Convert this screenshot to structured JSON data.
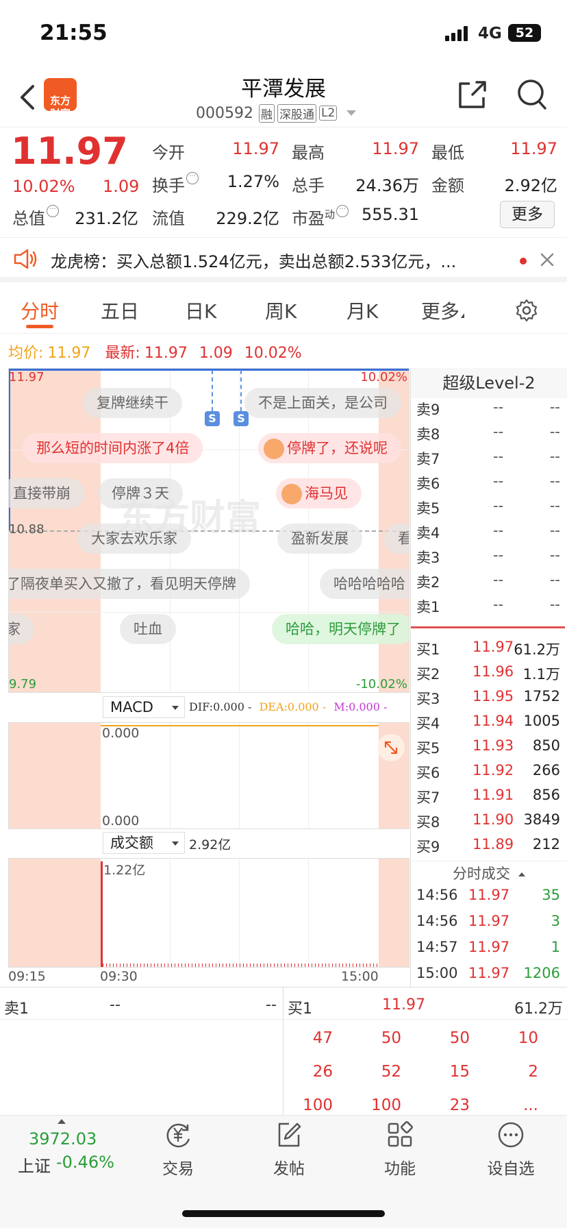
{
  "status": {
    "time": "21:55",
    "network": "4G",
    "battery": "52"
  },
  "nav": {
    "brand": "东方\n财富",
    "title": "平潭发展",
    "code": "000592",
    "badges": [
      "融",
      "深股通",
      "L2"
    ]
  },
  "quote": {
    "price": "11.97",
    "change_pct": "10.02%",
    "change": "1.09",
    "labels": {
      "open": "今开",
      "high": "最高",
      "low": "最低",
      "turnover_rate": "换手",
      "volume": "总手",
      "amount": "金额",
      "total_mv": "总值",
      "float_mv": "流值",
      "pe": "市盈",
      "pe_sup": "动",
      "more": "更多"
    },
    "values": {
      "open": "11.97",
      "high": "11.97",
      "low": "11.97",
      "turnover_rate": "1.27%",
      "volume": "24.36万",
      "amount": "2.92亿",
      "total_mv": "231.2亿",
      "float_mv": "229.2亿",
      "pe": "555.31"
    }
  },
  "notice": {
    "text": "龙虎榜：买入总额1.524亿元，卖出总额2.533亿元，..."
  },
  "tabs": [
    "分时",
    "五日",
    "日K",
    "周K",
    "月K",
    "更多"
  ],
  "info_line": {
    "avg_label": "均价:",
    "avg": "11.97",
    "last_label": "最新:",
    "last": "11.97",
    "chg": "1.09",
    "pct": "10.02%"
  },
  "chart": {
    "y_top": "11.97",
    "y_mid": "10.88",
    "y_bot": "9.79",
    "pct_top": "10.02%",
    "pct_bot": "-10.02%",
    "macd": {
      "label": "MACD",
      "dif": "DIF:0.000 -",
      "dea": "DEA:0.000 -",
      "m": "M:0.000 -",
      "top": "0.000",
      "bot": "0.000"
    },
    "vol": {
      "label": "成交额",
      "total": "2.92亿",
      "peak": "1.22亿"
    },
    "times": [
      "09:15",
      "09:30",
      "15:00"
    ],
    "markers": [
      "S",
      "S"
    ],
    "danmu": [
      "复牌继续干",
      "不是上面关，是公司",
      "那么短的时间内涨了4倍",
      "停牌了，还说呢",
      "直接带崩",
      "停牌３天",
      "海马见",
      "大家去欢乐家",
      "盈新发展",
      "看",
      "了隔夜单买入又撤了，看见明天停牌",
      "哈哈哈哈哈",
      "家",
      "吐血",
      "哈哈，明天停牌了"
    ]
  },
  "chart_data": {
    "type": "line",
    "title": "",
    "x": [
      "09:15",
      "09:30",
      "15:00"
    ],
    "series": [
      {
        "values": [
          11.97,
          11.97,
          11.97
        ]
      }
    ],
    "ylim": [
      9.79,
      11.97
    ],
    "volume_peak": "1.22亿"
  },
  "orderbook": {
    "title": "超级Level-2",
    "sells": [
      {
        "label": "卖9",
        "price": "--",
        "vol": "--"
      },
      {
        "label": "卖8",
        "price": "--",
        "vol": "--"
      },
      {
        "label": "卖7",
        "price": "--",
        "vol": "--"
      },
      {
        "label": "卖6",
        "price": "--",
        "vol": "--"
      },
      {
        "label": "卖5",
        "price": "--",
        "vol": "--"
      },
      {
        "label": "卖4",
        "price": "--",
        "vol": "--"
      },
      {
        "label": "卖3",
        "price": "--",
        "vol": "--"
      },
      {
        "label": "卖2",
        "price": "--",
        "vol": "--"
      },
      {
        "label": "卖1",
        "price": "--",
        "vol": "--"
      }
    ],
    "buys": [
      {
        "label": "买1",
        "price": "11.97",
        "vol": "61.2万"
      },
      {
        "label": "买2",
        "price": "11.96",
        "vol": "1.1万"
      },
      {
        "label": "买3",
        "price": "11.95",
        "vol": "1752"
      },
      {
        "label": "买4",
        "price": "11.94",
        "vol": "1005"
      },
      {
        "label": "买5",
        "price": "11.93",
        "vol": "850"
      },
      {
        "label": "买6",
        "price": "11.92",
        "vol": "266"
      },
      {
        "label": "买7",
        "price": "11.91",
        "vol": "856"
      },
      {
        "label": "买8",
        "price": "11.90",
        "vol": "3849"
      },
      {
        "label": "买9",
        "price": "11.89",
        "vol": "212"
      }
    ]
  },
  "trades": {
    "title": "分时成交",
    "rows": [
      {
        "time": "14:56",
        "price": "11.97",
        "vol": "35"
      },
      {
        "time": "14:56",
        "price": "11.97",
        "vol": "3"
      },
      {
        "time": "14:57",
        "price": "11.97",
        "vol": "1"
      },
      {
        "time": "15:00",
        "price": "11.97",
        "vol": "1206"
      }
    ]
  },
  "queue": {
    "sell_label": "卖1",
    "sell_price": "--",
    "sell_vol": "--",
    "buy_label": "买1",
    "buy_price": "11.97",
    "buy_vol": "61.2万",
    "rows": [
      [
        "47",
        "50",
        "50",
        "10"
      ],
      [
        "26",
        "52",
        "15",
        "2"
      ],
      [
        "100",
        "100",
        "23",
        "..."
      ]
    ]
  },
  "tabbar": {
    "index_value": "3972.03",
    "index_name": "上证",
    "index_pct": "-0.46%",
    "items": [
      "交易",
      "发帖",
      "功能",
      "设自选"
    ]
  }
}
